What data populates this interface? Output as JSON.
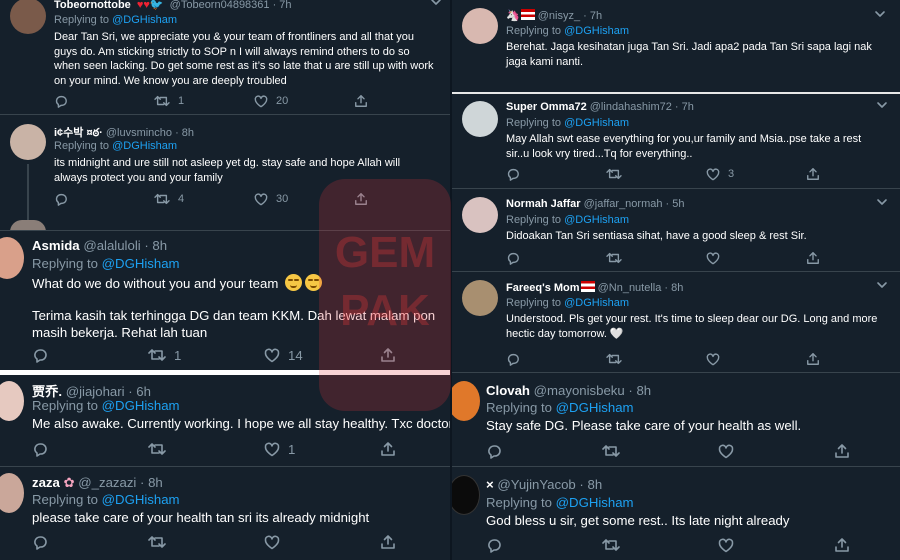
{
  "watermark": {
    "text": "GEMPAK"
  },
  "left": [
    {
      "display_name": "Tobeornottobe",
      "handle": "@Tobeorn04898361 · 7h",
      "replying": "Replying to",
      "mention": "@DGHisham",
      "text": "Dear Tan Sri, we appreciate you & your team of frontliners and all that you guys do. Am sticking  strictly to SOP n I will always remind others to do so when seen lacking. Do get some rest as it’s so late that u are still up with work on your mind. We know you are deeply troubled",
      "retweets": "1",
      "likes": "20",
      "avatar_color": "#7a5a4a"
    },
    {
      "display_name": "i¢수박 ¤ఠ·",
      "handle": "@luvsmincho · 8h",
      "replying": "Replying to",
      "mention": "@DGHisham",
      "text": "its midnight and ure still not asleep yet dg. stay safe and hope Allah will always protect you and your family",
      "retweets": "4",
      "likes": "30",
      "avatar_color": "#c9b3a6"
    },
    {
      "display_name": "Asmida",
      "handle": "@alaluloli · 8h",
      "replying": "Replying to",
      "mention": "@DGHisham",
      "text": "What do we do without you and your team",
      "text2": "Terima kasih tak terhingga DG dan team KKM. Dah lewat malam pon masih bekerja. Rehat lah tuan",
      "retweets": "1",
      "likes": "14",
      "avatar_color": "#d9a08a"
    },
    {
      "display_name": "贾乔.",
      "handle": "@jiajohari · 6h",
      "replying": "Replying to",
      "mention": "@DGHisham",
      "text": "Me also awake. Currently working. I hope we all stay healthy. Txc doctor",
      "likes": "1",
      "avatar_color": "#e6c9c0"
    },
    {
      "display_name": "zaza",
      "handle": "@_zazazi · 8h",
      "replying": "Replying to",
      "mention": "@DGHisham",
      "text": "please take care of your health tan sri its already midnight",
      "avatar_color": "#caa79a"
    }
  ],
  "right": [
    {
      "display_name": "",
      "handle": "@nisyz_ · 7h",
      "replying": "Replying to",
      "mention": "@DGHisham",
      "text": "Berehat. Jaga kesihatan juga Tan Sri. Jadi apa2 pada Tan Sri sapa lagi nak jaga kami nanti.",
      "avatar_color": "#d8b8b0"
    },
    {
      "display_name": "Super Omma72",
      "handle": "@lindahashim72 · 7h",
      "replying": "Replying to",
      "mention": "@DGHisham",
      "text": "May Allah swt ease everything for you,ur family and Msia..pse take a rest sir..u look vry tired...Tq for everything..",
      "likes": "3",
      "avatar_color": "#cfd6d8"
    },
    {
      "display_name": "Normah Jaffar",
      "handle": "@jaffar_normah · 5h",
      "replying": "Replying to",
      "mention": "@DGHisham",
      "text": "Didoakan Tan Sri sentiasa sihat, have a good sleep & rest Sir.",
      "avatar_color": "#d9c2c0"
    },
    {
      "display_name": "Fareeq's Mom",
      "handle": "@Nn_nutella · 8h",
      "replying": "Replying to",
      "mention": "@DGHisham",
      "text": "Understood. Pls get your rest. It's time to sleep dear our DG. Long and more hectic day tomorrow. 🤍",
      "avatar_color": "#a88f70"
    },
    {
      "display_name": "Clovah",
      "handle": "@mayonisbeku · 8h",
      "replying": "Replying to",
      "mention": "@DGHisham",
      "text": "Stay safe DG.  Please take care of your health as well.",
      "avatar_color": "#e0782a"
    },
    {
      "display_name": "×",
      "handle": "@YujinYacob · 8h",
      "replying": "Replying to",
      "mention": "@DGHisham",
      "text": "God bless u sir, get some rest.. Its late night already",
      "avatar_color": "#0b0b0b"
    }
  ],
  "colors": {
    "bg": "#15202b",
    "muted": "#8899a6",
    "link": "#1da1f2",
    "divider": "#38444d"
  },
  "icons": [
    "reply-icon",
    "retweet-icon",
    "like-icon",
    "share-icon",
    "caret-down-icon"
  ]
}
